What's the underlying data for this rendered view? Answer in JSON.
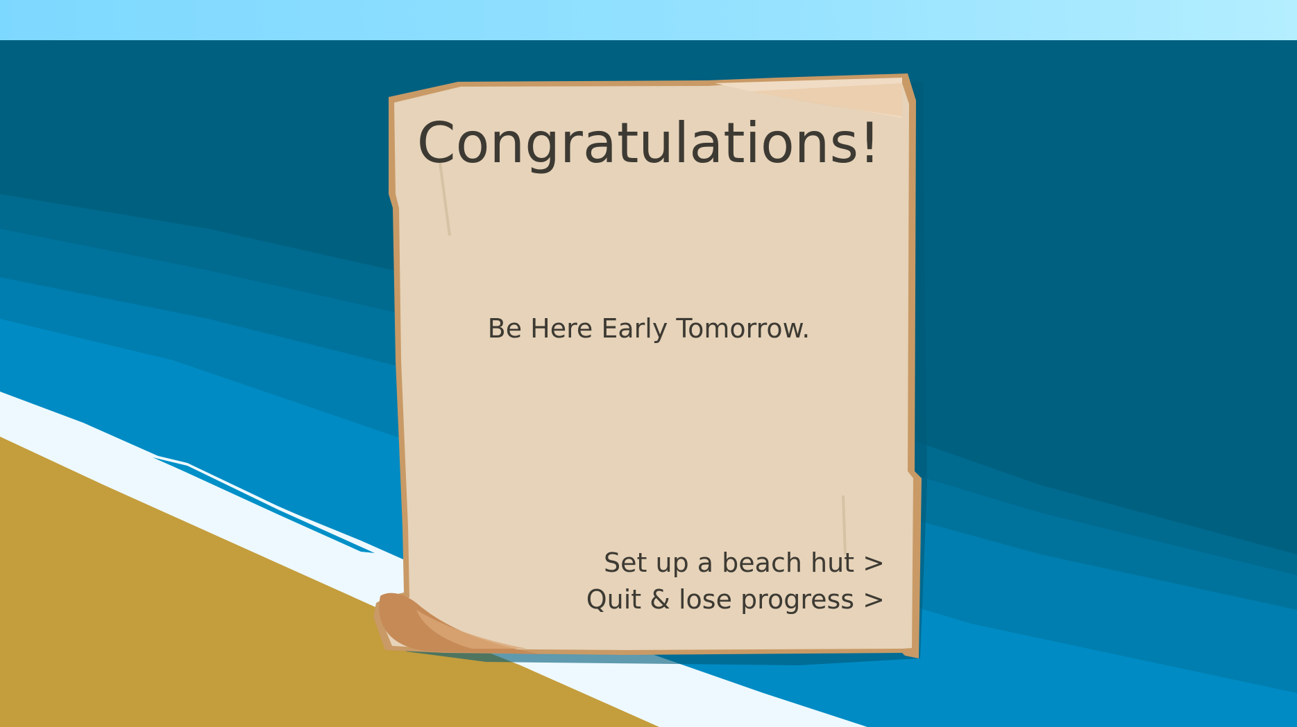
{
  "dialog": {
    "title": "Congratulations!",
    "message": "Be Here Early Tomorrow.",
    "options": [
      {
        "label": "Set up a beach hut >"
      },
      {
        "label": "Quit & lose progress >"
      }
    ]
  },
  "colors": {
    "sky_top": "#7dd8ff",
    "sky_light": "#b0ecff",
    "deep_sea": "#006080",
    "sea_mid": "#0076a4",
    "sea_shallow": "#008cc5",
    "foam": "#eef9ff",
    "sand": "#c49d3c",
    "parchment": "#e6d3b9",
    "parchment_edge": "#c99a66",
    "text": "#3d3a33"
  }
}
